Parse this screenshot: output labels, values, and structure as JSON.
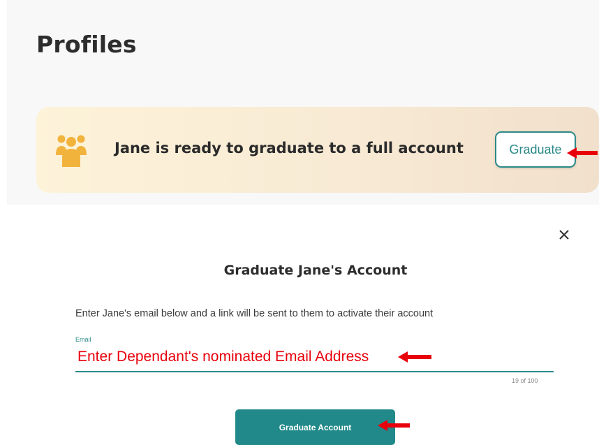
{
  "profiles_panel": {
    "title": "Profiles",
    "banner": {
      "icon": "group-people-icon",
      "icon_color": "#f2b33d",
      "message": "Jane is ready to graduate to a full account",
      "graduate_button_label": "Graduate"
    }
  },
  "modal": {
    "close_icon": "close-icon",
    "title": "Graduate Jane's Account",
    "instructions": "Enter Jane's email below and a link will be sent to them to activate their account",
    "email_field": {
      "label": "Email",
      "value": "Enter Dependant's nominated Email Address",
      "counter": "19 of 100"
    },
    "submit_button_label": "Graduate Account"
  },
  "annotations": {
    "arrow_color": "#e8000b",
    "arrow_icon": "left-arrow-icon"
  },
  "colors": {
    "accent": "#2b8a88",
    "button_fill": "#21898a",
    "banner_start": "#fdf3d9",
    "banner_end": "#f1e0cc",
    "annotation_text": "#e8000b"
  }
}
